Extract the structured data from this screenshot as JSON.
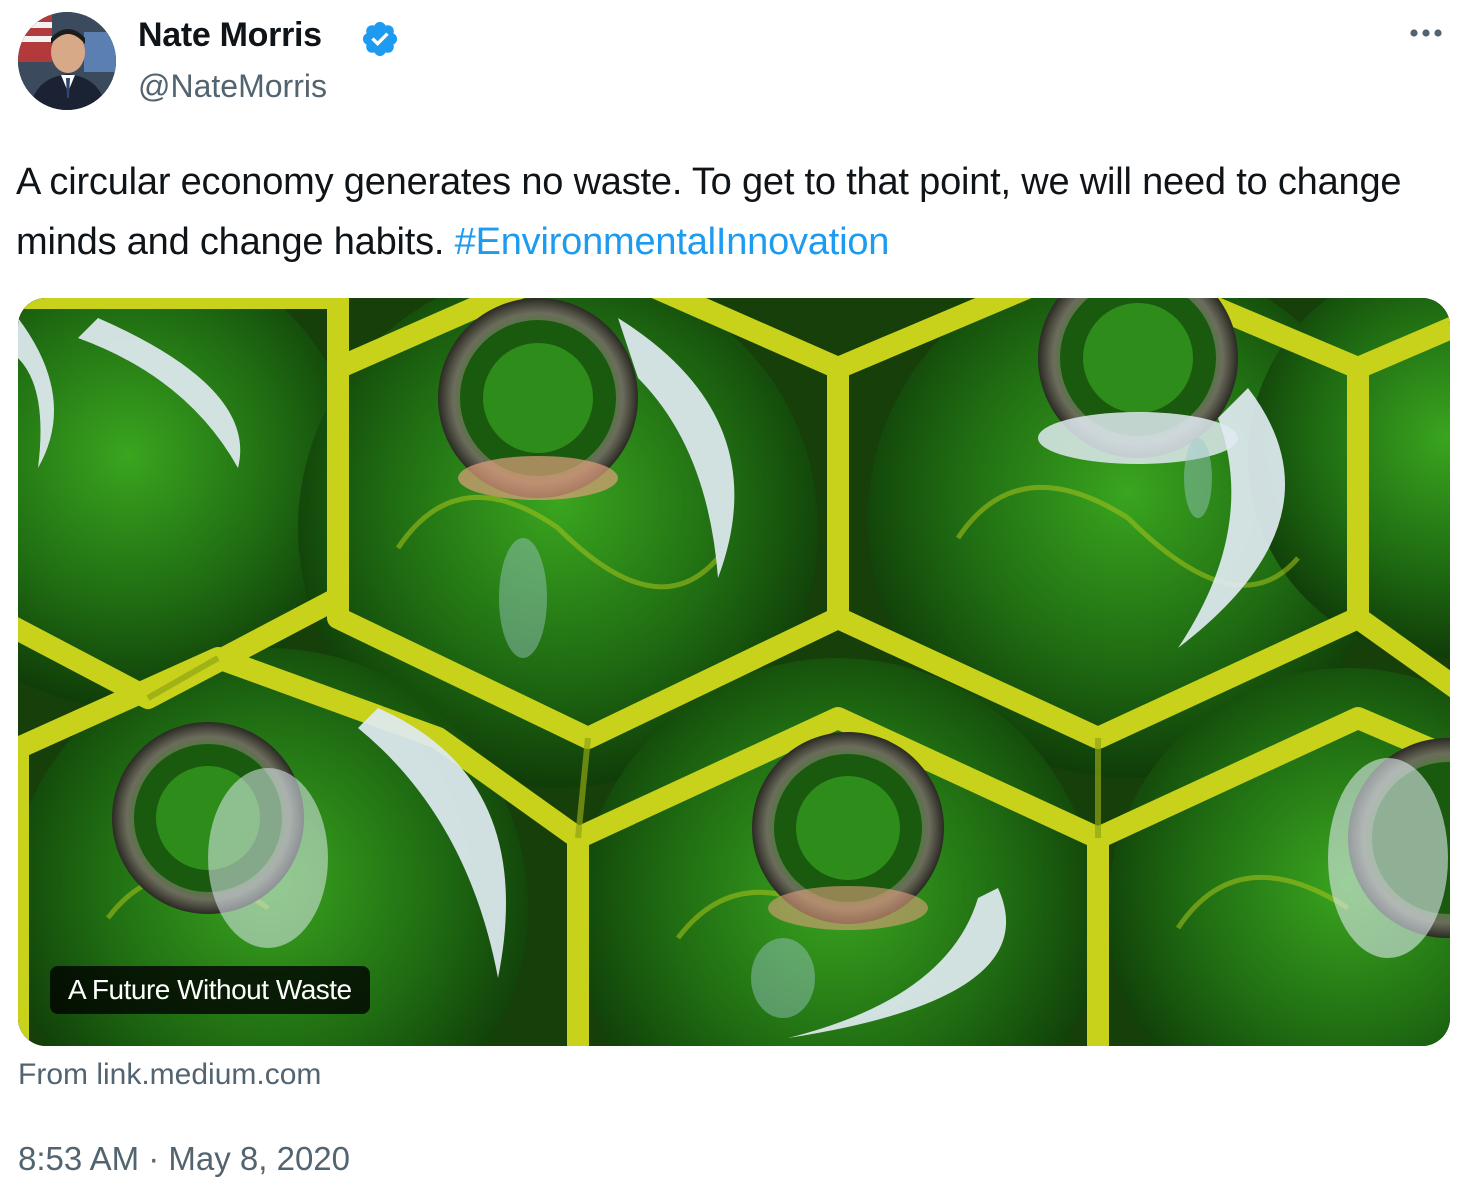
{
  "tweet": {
    "author_name": "Nate Morris",
    "author_handle": "@NateMorris",
    "text_main": "A circular economy generates no waste. To get to that point, we will need to change minds and change habits.",
    "hashtag": "#EnvironmentalInnovation",
    "card_title": "A Future Without Waste",
    "card_source": "From link.medium.com",
    "timestamp": "8:53 AM · May 8, 2020"
  },
  "icons": {
    "verified": "verified-badge-icon",
    "more": "more-options-icon"
  },
  "colors": {
    "link": "#1d9bf0",
    "verified": "#1d9bf0",
    "secondary_text": "#536471",
    "crate": "#c8d21a",
    "glass": "#1f6b12"
  }
}
